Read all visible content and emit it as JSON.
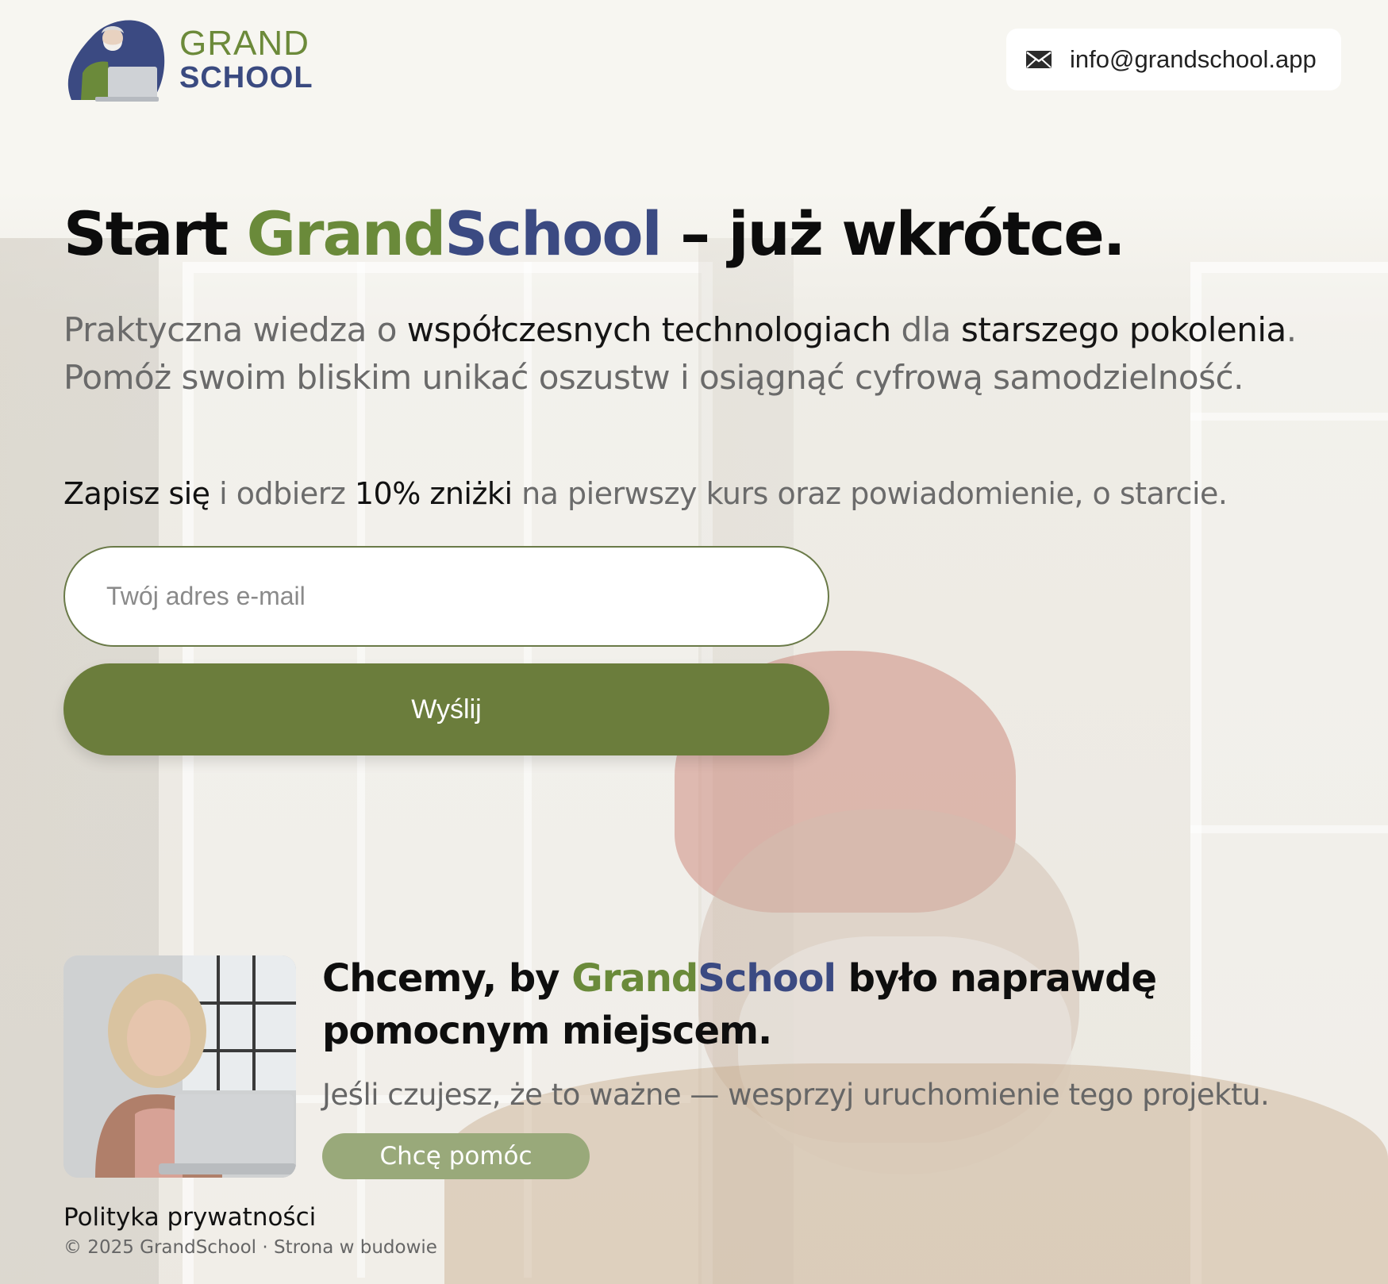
{
  "header": {
    "logo_grand": "GRAND",
    "logo_school": "SCHOOL",
    "contact_email": "info@grandschool.app"
  },
  "hero": {
    "title_start": "Start ",
    "title_grand": "Grand",
    "title_school": "School",
    "title_end": " – już wkrótce.",
    "sub_1": "Praktyczna wiedza o ",
    "sub_2": "współczesnych technologiach",
    "sub_3": " dla ",
    "sub_4": "starszego pokolenia",
    "sub_5": ".",
    "sub_line2": "Pomóż swoim bliskim unikać oszustw i osiągnąć cyfrową samodzielność."
  },
  "signup": {
    "text_1": "Zapisz się",
    "text_2": " i odbierz ",
    "text_3": "10% zniżki",
    "text_4": " na pierwszy kurs oraz powiadomienie, o starcie.",
    "email_placeholder": "Twój adres e-mail",
    "email_value": "",
    "submit_label": "Wyślij"
  },
  "support": {
    "title_1": "Chcemy, by ",
    "title_grand": "Grand",
    "title_school": "School",
    "title_2": " było naprawdę pomocnym miejscem.",
    "subtitle": "Jeśli czujesz, że to ważne — wesprzyj uruchomienie tego projektu.",
    "button_label": "Chcę pomóc"
  },
  "footer": {
    "privacy": "Polityka prywatności",
    "copyright": "© 2025 GrandSchool · Strona w budowie"
  },
  "colors": {
    "accent_green": "#6b7d3c",
    "brand_navy": "#3b4a82",
    "brand_green": "#6a8a3a"
  },
  "icons": {
    "contact": "mail-icon",
    "logo": "grandpa-laptop-logo"
  }
}
